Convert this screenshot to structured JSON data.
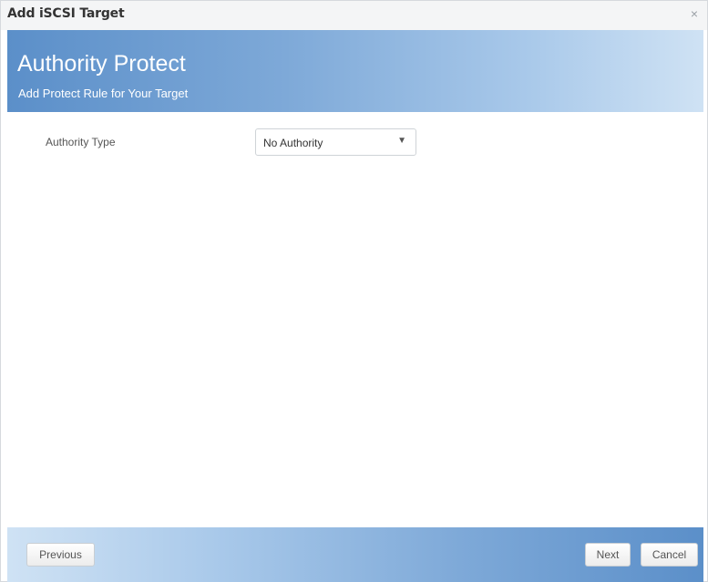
{
  "window": {
    "title": "Add iSCSI Target",
    "close_glyph": "×"
  },
  "banner": {
    "title": "Authority Protect",
    "subtitle": "Add Protect Rule for Your Target"
  },
  "form": {
    "authority_type_label": "Authority Type",
    "authority_type_value": "No Authority",
    "dropdown_arrow": "▼"
  },
  "footer": {
    "previous_label": "Previous",
    "next_label": "Next",
    "cancel_label": "Cancel"
  },
  "colors": {
    "banner_gradient_start": "#5b8fc9",
    "banner_gradient_end": "#cfe2f4",
    "title_text": "#333333"
  }
}
